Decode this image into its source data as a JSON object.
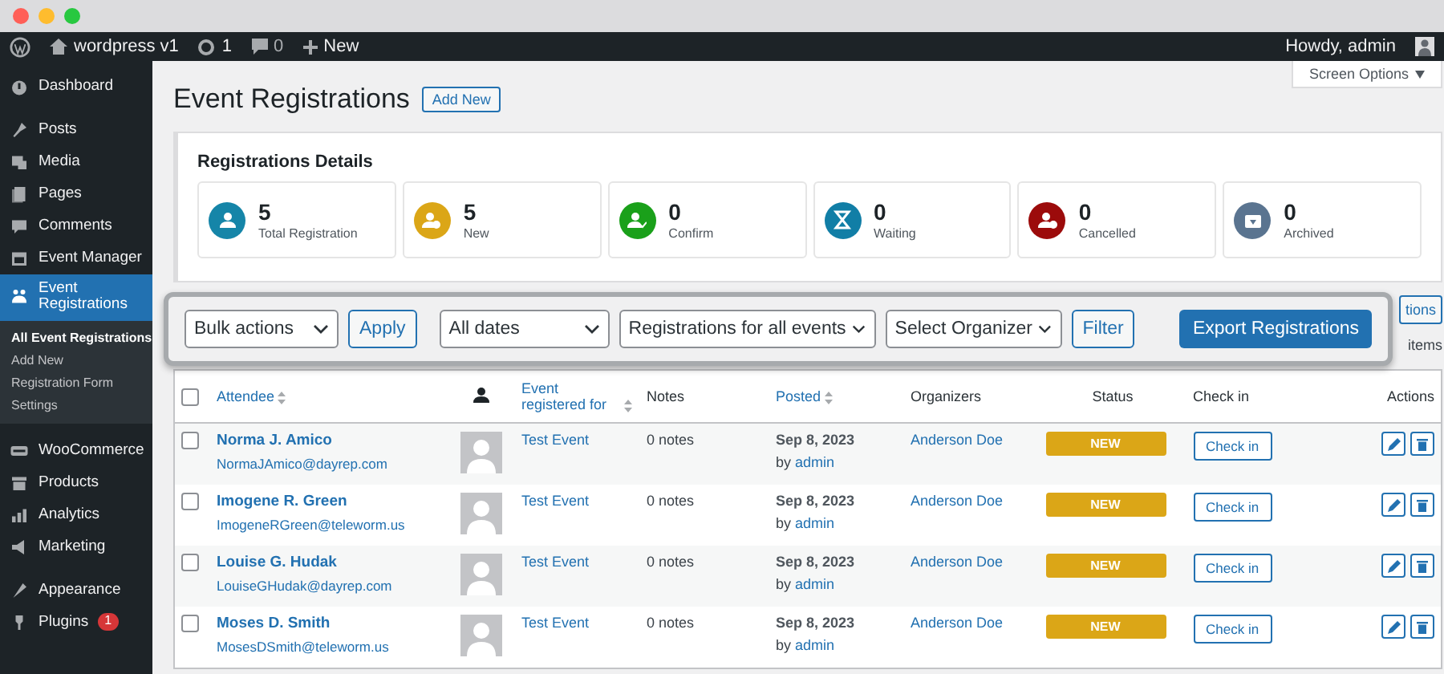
{
  "admin_bar": {
    "site": "wordpress v1",
    "updates": "1",
    "comments": "0",
    "new": "New",
    "greeting": "Howdy, admin"
  },
  "sidebar": {
    "groups": [
      [
        {
          "label": "Dashboard",
          "selected": false
        }
      ],
      [
        {
          "label": "Posts",
          "selected": false
        },
        {
          "label": "Media",
          "selected": false
        },
        {
          "label": "Pages",
          "selected": false
        },
        {
          "label": "Comments",
          "selected": false
        },
        {
          "label": "Event Manager",
          "selected": false
        },
        {
          "label": "Event Registrations",
          "selected": true,
          "children": [
            {
              "label": "All Event Registrations",
              "selected": true
            },
            {
              "label": "Add New",
              "selected": false
            },
            {
              "label": "Registration Form",
              "selected": false
            },
            {
              "label": "Settings",
              "selected": false
            }
          ]
        }
      ],
      [
        {
          "label": "WooCommerce",
          "selected": false
        },
        {
          "label": "Products",
          "selected": false
        },
        {
          "label": "Analytics",
          "selected": false
        },
        {
          "label": "Marketing",
          "selected": false
        }
      ],
      [
        {
          "label": "Appearance",
          "selected": false
        },
        {
          "label": "Plugins",
          "badge": "1"
        }
      ]
    ]
  },
  "screen_options": "Screen Options",
  "page": {
    "title": "Event Registrations",
    "add_new": "Add New"
  },
  "details": {
    "title": "Registrations Details",
    "stats": [
      {
        "value": "5",
        "label": "Total Registration",
        "color": "#1585a8"
      },
      {
        "value": "5",
        "label": "New",
        "color": "#dba617"
      },
      {
        "value": "0",
        "label": "Confirm",
        "color": "#1aa01a"
      },
      {
        "value": "0",
        "label": "Waiting",
        "color": "#117ea6"
      },
      {
        "value": "0",
        "label": "Cancelled",
        "color": "#9c0b0b"
      },
      {
        "value": "0",
        "label": "Archived",
        "color": "#5a7490"
      }
    ]
  },
  "filters": {
    "bulk_actions": "Bulk actions",
    "apply": "Apply",
    "dates": "All dates",
    "events": "Registrations for all events",
    "organizer": "Select Organizer",
    "filter": "Filter",
    "export": "Export Registrations"
  },
  "behind_overlay": {
    "button": "tions",
    "count": "items"
  },
  "table": {
    "select_all": {
      "checked": false
    },
    "columns": [
      {
        "label": "Attendee",
        "kind": "sortable"
      },
      {
        "kind": "icon"
      },
      {
        "label": "Event registered for",
        "kind": "sortable"
      },
      {
        "label": "Notes",
        "kind": "plain"
      },
      {
        "label": "Posted",
        "kind": "sortable"
      },
      {
        "label": "Organizers",
        "kind": "plain"
      },
      {
        "label": "Status",
        "kind": "plain"
      },
      {
        "label": "Check in",
        "kind": "plain"
      },
      {
        "label": "Actions",
        "kind": "plain"
      }
    ],
    "rows": [
      {
        "checked": false,
        "name": "Norma J. Amico",
        "email": "NormaJAmico@dayrep.com",
        "event": "Test Event",
        "notes": "0 notes",
        "date": "Sep 8, 2023",
        "by": "by",
        "author": "admin",
        "organizer": "Anderson Doe",
        "status": "NEW",
        "check_in": "Check in"
      },
      {
        "checked": false,
        "name": "Imogene R. Green",
        "email": "ImogeneRGreen@teleworm.us",
        "event": "Test Event",
        "notes": "0 notes",
        "date": "Sep 8, 2023",
        "by": "by",
        "author": "admin",
        "organizer": "Anderson Doe",
        "status": "NEW",
        "check_in": "Check in"
      },
      {
        "checked": false,
        "name": "Louise G. Hudak",
        "email": "LouiseGHudak@dayrep.com",
        "event": "Test Event",
        "notes": "0 notes",
        "date": "Sep 8, 2023",
        "by": "by",
        "author": "admin",
        "organizer": "Anderson Doe",
        "status": "NEW",
        "check_in": "Check in"
      },
      {
        "checked": false,
        "name": "Moses D. Smith",
        "email": "MosesDSmith@teleworm.us",
        "event": "Test Event",
        "notes": "0 notes",
        "date": "Sep 8, 2023",
        "by": "by",
        "author": "admin",
        "organizer": "Anderson Doe",
        "status": "NEW",
        "check_in": "Check in"
      }
    ]
  }
}
